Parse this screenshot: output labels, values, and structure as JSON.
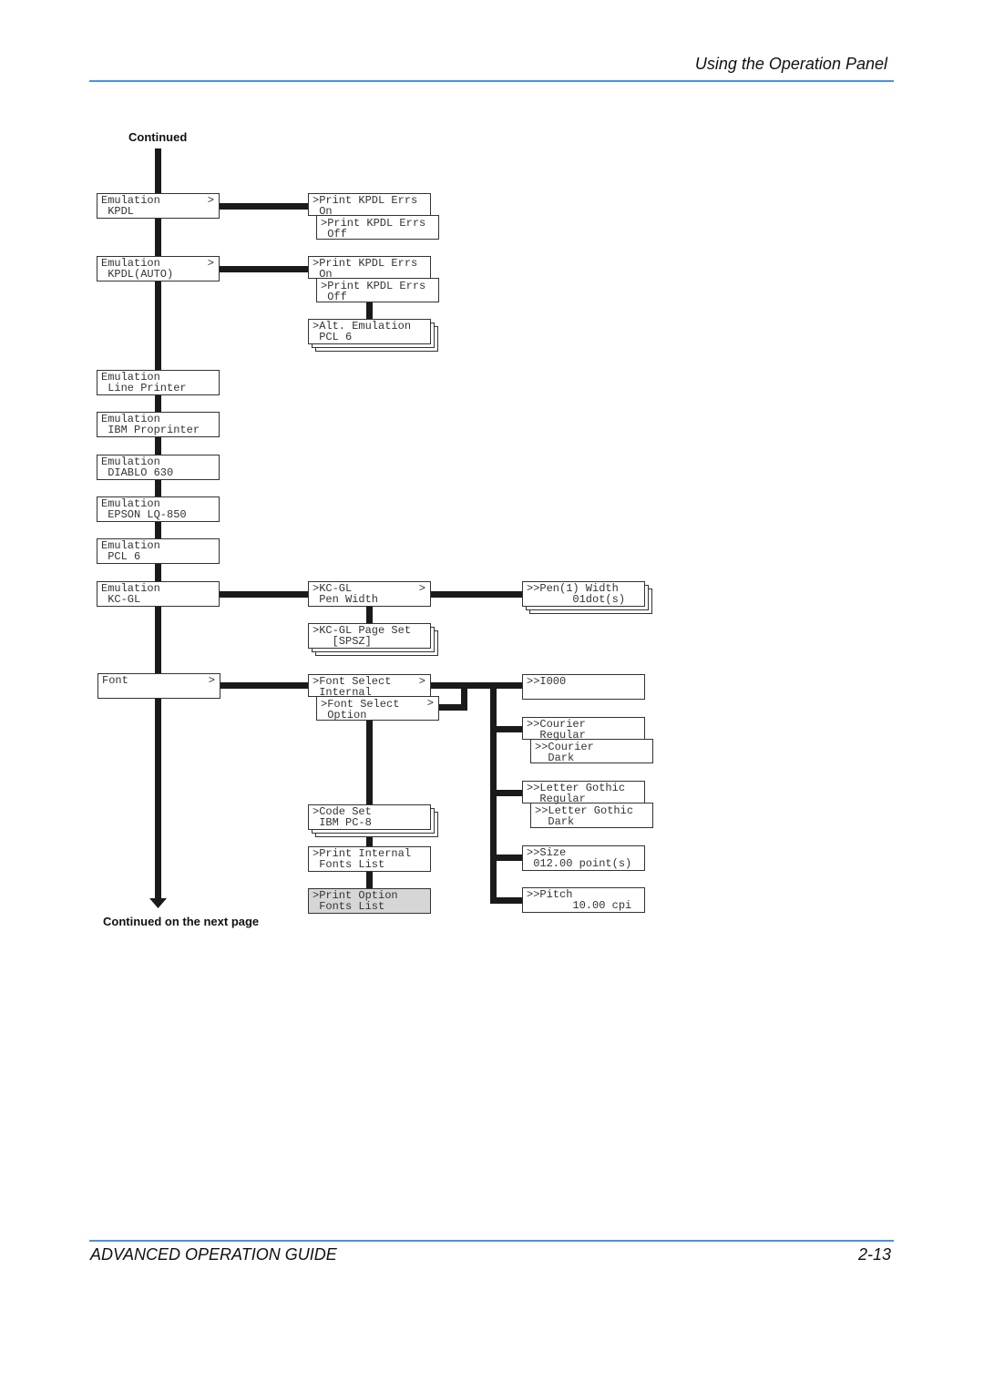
{
  "header": {
    "title": "Using the Operation Panel"
  },
  "footer": {
    "guide": "ADVANCED OPERATION GUIDE",
    "page": "2-13"
  },
  "labels": {
    "continued": "Continued",
    "continued_next": "Continued on the next page"
  },
  "colors": {
    "rule": "#4a90e2",
    "highlight": "#d6d6d6"
  },
  "left": [
    {
      "text": "Emulation\n KPDL",
      "arrow": ">"
    },
    {
      "text": "Emulation\n KPDL(AUTO)",
      "arrow": ">"
    },
    {
      "text": "Emulation\n Line Printer"
    },
    {
      "text": "Emulation\n IBM Proprinter"
    },
    {
      "text": "Emulation\n DIABLO 630"
    },
    {
      "text": "Emulation\n EPSON LQ-850"
    },
    {
      "text": "Emulation\n PCL 6"
    },
    {
      "text": "Emulation\n KC-GL"
    },
    {
      "text": "Font",
      "arrow": ">"
    }
  ],
  "mid": [
    {
      "text": ">Print KPDL Errs\n On"
    },
    {
      "text": ">Print KPDL Errs\n Off"
    },
    {
      "text": ">Print KPDL Errs\n On"
    },
    {
      "text": ">Print KPDL Errs\n Off"
    },
    {
      "text": ">Alt. Emulation\n PCL 6"
    },
    {
      "text": ">KC-GL\n Pen Width",
      "arrow": ">"
    },
    {
      "text": ">KC-GL Page Set\n   [SPSZ]"
    },
    {
      "text": ">Font Select\n Internal",
      "arrow": ">"
    },
    {
      "text": ">Font Select\n Option",
      "arrow": ">"
    },
    {
      "text": ">Code Set\n IBM PC-8"
    },
    {
      "text": ">Print Internal\n Fonts List"
    },
    {
      "text": ">Print Option\n Fonts List"
    }
  ],
  "right": [
    {
      "text": ">>Pen(1) Width\n       01dot(s)"
    },
    {
      "text": ">>I000"
    },
    {
      "text": ">>Courier\n  Regular"
    },
    {
      "text": ">>Courier\n  Dark"
    },
    {
      "text": ">>Letter Gothic\n  Regular"
    },
    {
      "text": ">>Letter Gothic\n  Dark"
    },
    {
      "text": ">>Size\n 012.00 point(s)"
    },
    {
      "text": ">>Pitch\n       10.00 cpi"
    }
  ]
}
